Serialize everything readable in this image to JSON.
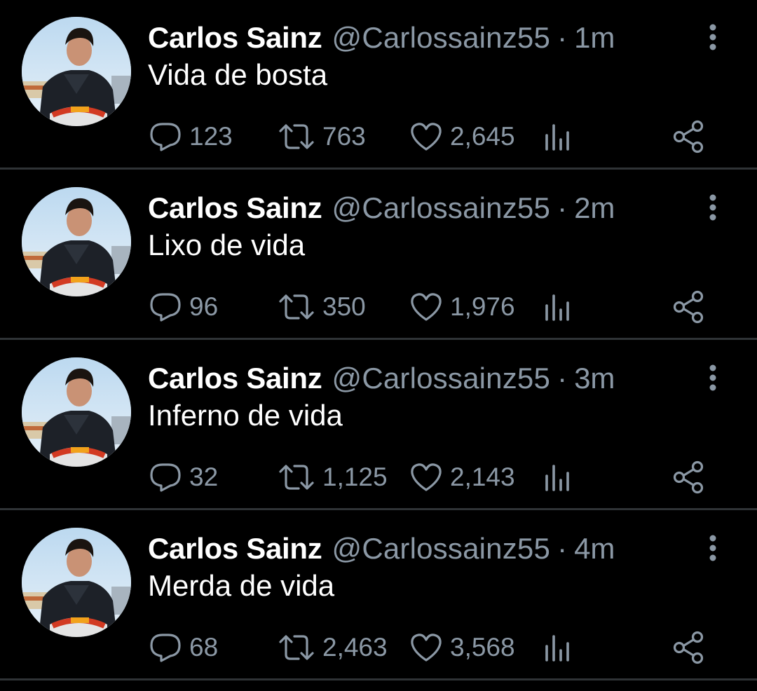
{
  "colors": {
    "background": "#000000",
    "divider": "#2f3336",
    "primary_text": "#ffffff",
    "secondary_text": "#8b98a5"
  },
  "tweets": [
    {
      "name": "Carlos Sainz",
      "handle": "@Carlossainz55",
      "separator": "·",
      "time": "1m",
      "text": "Vida de bosta",
      "replies": "123",
      "retweets": "763",
      "likes": "2,645"
    },
    {
      "name": "Carlos Sainz",
      "handle": "@Carlossainz55",
      "separator": "·",
      "time": "2m",
      "text": "Lixo de vida",
      "replies": "96",
      "retweets": "350",
      "likes": "1,976"
    },
    {
      "name": "Carlos Sainz",
      "handle": "@Carlossainz55",
      "separator": "·",
      "time": "3m",
      "text": "Inferno de vida",
      "replies": "32",
      "retweets": "1,125",
      "likes": "2,143"
    },
    {
      "name": "Carlos Sainz",
      "handle": "@Carlossainz55",
      "separator": "·",
      "time": "4m",
      "text": "Merda de vida",
      "replies": "68",
      "retweets": "2,463",
      "likes": "3,568"
    }
  ],
  "icons": {
    "reply": "reply-icon",
    "retweet": "retweet-icon",
    "like": "like-icon",
    "views": "views-icon",
    "share": "share-icon",
    "more": "more-options-icon"
  }
}
